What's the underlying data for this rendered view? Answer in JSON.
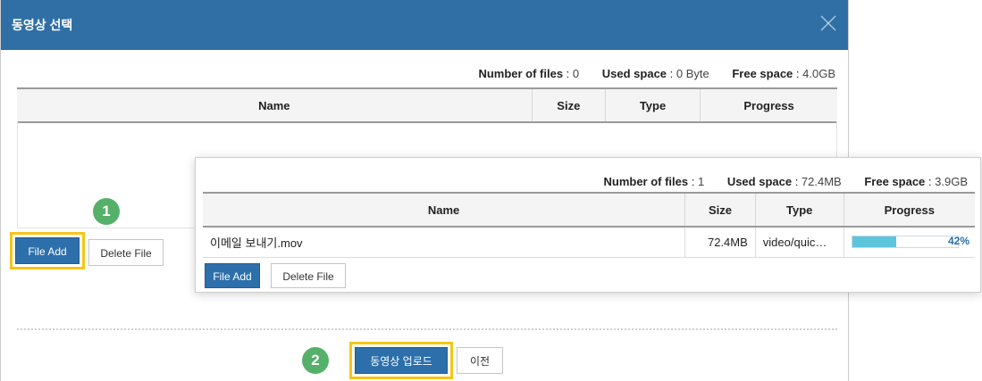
{
  "dialog": {
    "title": "동영상 선택",
    "stats": {
      "files_label": "Number of files",
      "files_value": "0",
      "used_label": "Used space",
      "used_value": "0 Byte",
      "free_label": "Free space",
      "free_value": "4.0GB"
    },
    "columns": [
      "Name",
      "Size",
      "Type",
      "Progress"
    ],
    "file_add_label": "File Add",
    "delete_file_label": "Delete File",
    "upload_label": "동영상 업로드",
    "prev_label": "이전"
  },
  "overlay": {
    "stats": {
      "files_label": "Number of files",
      "files_value": "1",
      "used_label": "Used space",
      "used_value": "72.4MB",
      "free_label": "Free space",
      "free_value": "3.9GB"
    },
    "columns": [
      "Name",
      "Size",
      "Type",
      "Progress"
    ],
    "rows": [
      {
        "name": "이메일 보내기.mov",
        "size": "72.4MB",
        "type": "video/quic…",
        "progress_text": "42%",
        "progress": 0.42
      }
    ],
    "file_add_label": "File Add",
    "delete_file_label": "Delete File"
  },
  "badges": [
    "1",
    "2"
  ],
  "colors": {
    "title_bar": "#2f6fa6",
    "button_blue": "#2c6fab",
    "highlight": "#f5c518",
    "badge": "#55b06a",
    "progress_fill": "#5bc5dc"
  },
  "icons": {
    "close": "close-icon"
  }
}
